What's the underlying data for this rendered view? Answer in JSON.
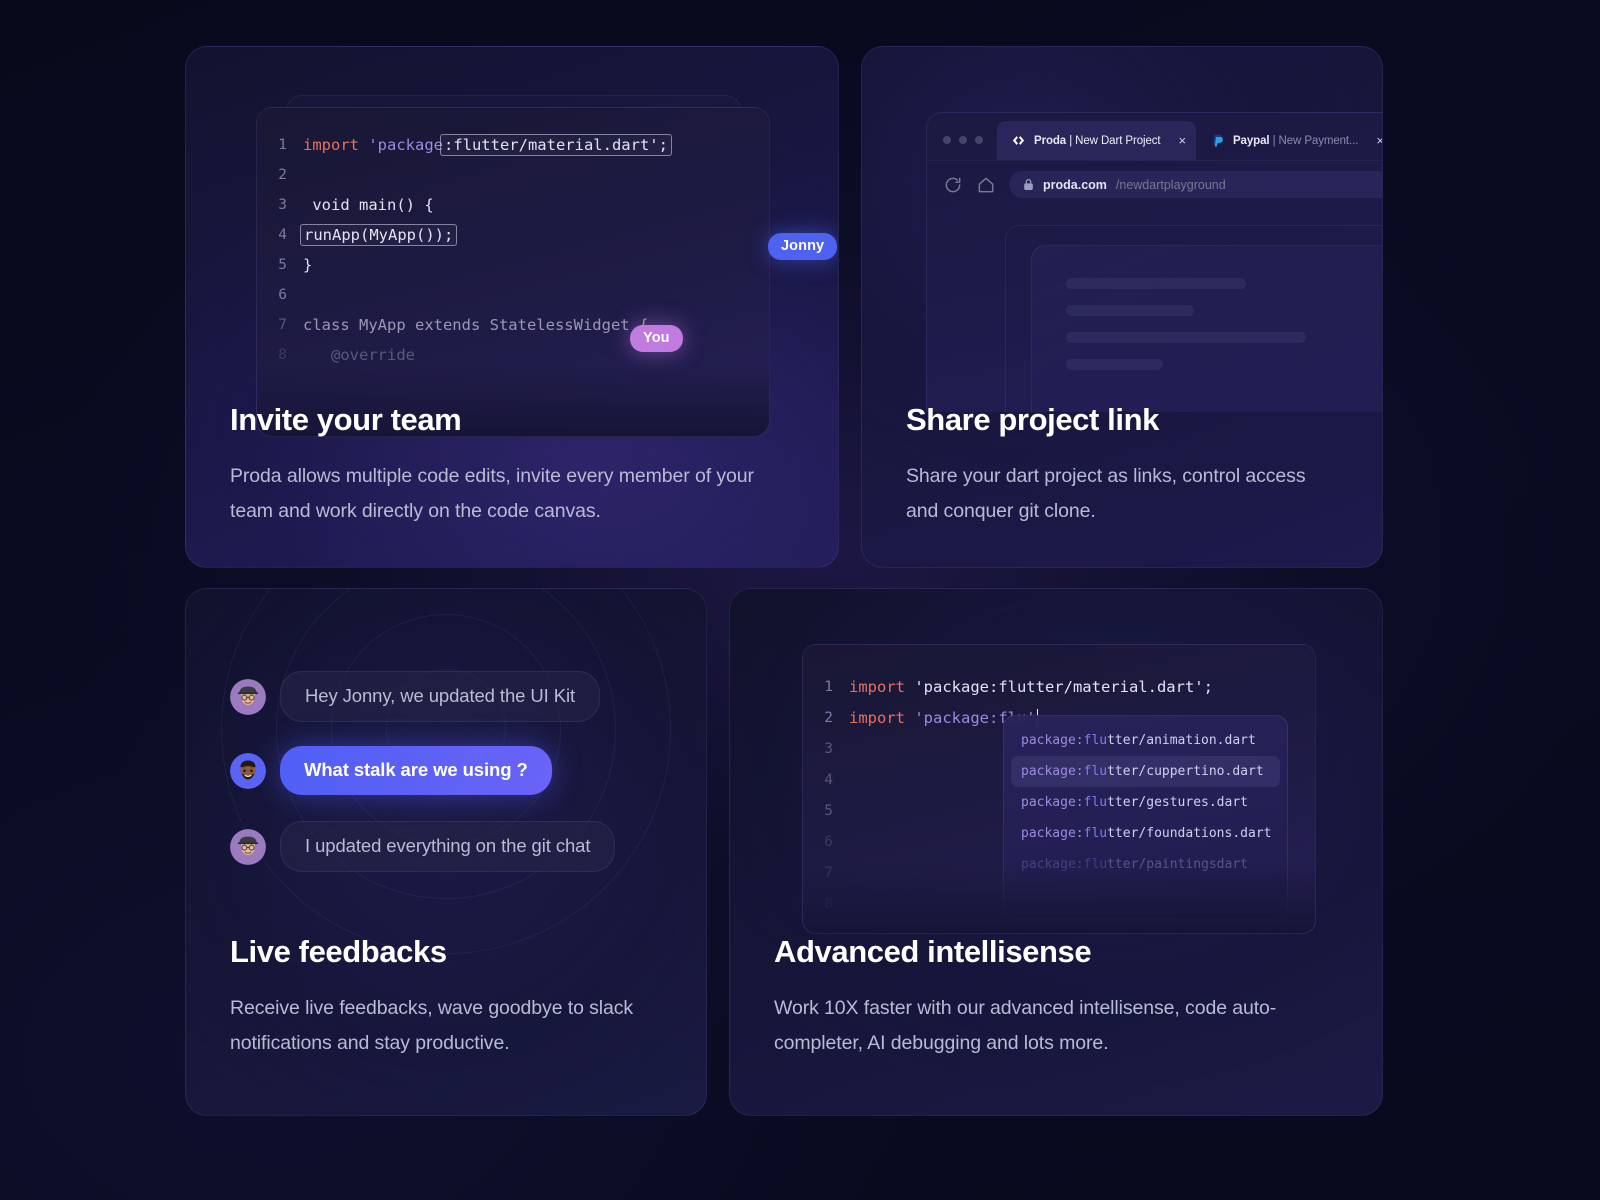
{
  "theme": {
    "page_bg": "#080a1c",
    "accent_blue": "#4d63f0",
    "accent_purple": "#c07ae0",
    "text_primary": "#ffffff",
    "text_secondary": "#b8bbd4"
  },
  "cards": [
    {
      "id": "invite",
      "title": "Invite your team",
      "description": "Proda allows multiple code edits, invite every member of your team and work directly on the code canvas.",
      "code_lines": [
        {
          "n": "1",
          "segments": [
            {
              "t": "import ",
              "c": "kw"
            },
            {
              "t": "'package",
              "c": "str"
            },
            {
              "t": ":flutter/material.dart';",
              "c": "sel"
            }
          ]
        },
        {
          "n": "2",
          "segments": []
        },
        {
          "n": "3",
          "segments": [
            {
              "t": " void main() {",
              "c": "plain"
            }
          ]
        },
        {
          "n": "4",
          "segments": [
            {
              "t": "runApp(MyApp());",
              "c": "sel"
            }
          ]
        },
        {
          "n": "5",
          "segments": [
            {
              "t": "}",
              "c": "plain"
            }
          ]
        },
        {
          "n": "6",
          "segments": []
        },
        {
          "n": "7",
          "segments": [
            {
              "t": "class MyApp extends StatelessWidget {",
              "c": "fade1"
            }
          ]
        },
        {
          "n": "8",
          "segments": [
            {
              "t": "   @override",
              "c": "fade2"
            }
          ]
        }
      ],
      "cursors": [
        {
          "name": "Jonny",
          "color": "#4d63f0"
        },
        {
          "name": "You",
          "color": "#c07ae0"
        }
      ]
    },
    {
      "id": "share",
      "title": "Share project link",
      "description": "Share your dart project as links, control access and conquer git clone.",
      "browser": {
        "tabs": [
          {
            "favicon": "code-brackets-icon",
            "title_bold": "Proda",
            "title_rest": " | New Dart Project",
            "active": true,
            "close": "×"
          },
          {
            "favicon": "paypal-icon",
            "title_bold": "Paypal",
            "title_rest": " | New Payment...",
            "active": false,
            "close": "×"
          }
        ],
        "reload_icon": "reload-icon",
        "home_icon": "home-icon",
        "lock_icon": "lock-icon",
        "url_host": "proda.com",
        "url_path": "/newdartplayground",
        "avatar": "user-avatar"
      }
    },
    {
      "id": "feedback",
      "title": "Live feedbacks",
      "description": "Receive live feedbacks, wave goodbye to slack notifications and stay productive.",
      "messages": [
        {
          "text": "Hey Jonny, we updated the UI Kit",
          "style": "plain",
          "avatar": "avatar-glasses-cap"
        },
        {
          "text": "What stalk are we using ?",
          "style": "accent",
          "avatar": "avatar-beard"
        },
        {
          "text": "I updated everything on the git chat",
          "style": "plain",
          "avatar": "avatar-glasses-cap"
        }
      ]
    },
    {
      "id": "intellisense",
      "title": "Advanced intellisense",
      "description": "Work 10X faster with our advanced intellisense, code auto-completer, AI debugging and lots more.",
      "code_lines": [
        {
          "n": "1",
          "segments": [
            {
              "t": "import ",
              "c": "kw"
            },
            {
              "t": "'package:flutter/material.dart';",
              "c": "plain"
            }
          ]
        },
        {
          "n": "2",
          "segments": [
            {
              "t": "import ",
              "c": "kw"
            },
            {
              "t": "'package:flu'",
              "c": "str"
            },
            {
              "t": "|",
              "c": "caret"
            }
          ]
        },
        {
          "n": "3",
          "segments": []
        },
        {
          "n": "4",
          "segments": []
        },
        {
          "n": "5",
          "segments": []
        },
        {
          "n": "6",
          "segments": []
        },
        {
          "n": "7",
          "segments": []
        },
        {
          "n": "8",
          "segments": []
        }
      ],
      "suggestions": [
        {
          "prefix": "package:",
          "match": "flu",
          "rest": "tter/animation.dart",
          "selected": false,
          "dim": false
        },
        {
          "prefix": "package:",
          "match": "flu",
          "rest": "tter/cuppertino.dart",
          "selected": true,
          "dim": false
        },
        {
          "prefix": "package:",
          "match": "flu",
          "rest": "tter/gestures.dart",
          "selected": false,
          "dim": false
        },
        {
          "prefix": "package:",
          "match": "flu",
          "rest": "tter/foundations.dart",
          "selected": false,
          "dim": false
        },
        {
          "prefix": "package:",
          "match": "flu",
          "rest": "tter/paintingsdart",
          "selected": false,
          "dim": true
        }
      ]
    }
  ]
}
